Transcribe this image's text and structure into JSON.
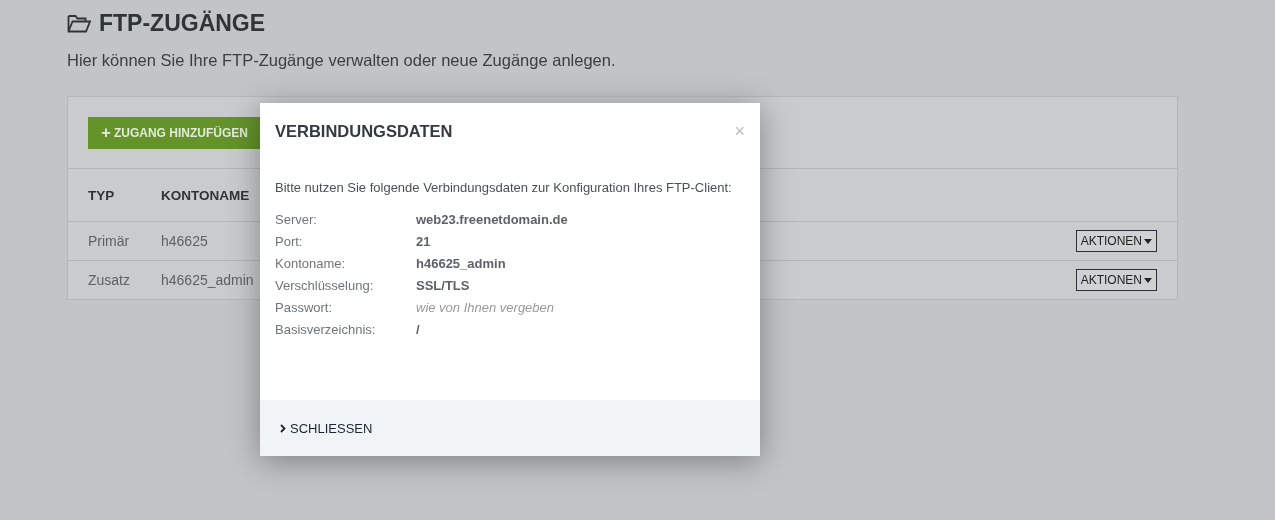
{
  "page": {
    "title": "FTP-ZUGÄNGE",
    "subtitle": "Hier können Sie Ihre FTP-Zugänge verwalten oder neue Zugänge anlegen."
  },
  "card": {
    "add_button": "ZUGANG HINZUFÜGEN",
    "add_icon": "+",
    "table": {
      "columns": [
        "TYP",
        "KONTONAME"
      ],
      "rows": [
        {
          "cells": [
            "Primär",
            "h46625"
          ],
          "action": "AKTIONEN"
        },
        {
          "cells": [
            "Zusatz",
            "h46625_admin"
          ],
          "action": "AKTIONEN"
        }
      ]
    }
  },
  "modal": {
    "title": "VERBINDUNGSDATEN",
    "close": "×",
    "intro": "Bitte nutzen Sie folgende Verbindungsdaten zur Konfiguration Ihres FTP-Client:",
    "details": [
      {
        "label": "Server:",
        "value": "web23.freenetdomain.de",
        "kind": "value"
      },
      {
        "label": "Port:",
        "value": "21",
        "kind": "value"
      },
      {
        "label": "Kontoname:",
        "value": "h46625_admin",
        "kind": "value"
      },
      {
        "label": "Verschlüsselung:",
        "value": "SSL/TLS",
        "kind": "value"
      },
      {
        "label": "Passwort:",
        "value": "wie von Ihnen vergeben",
        "kind": "hint"
      },
      {
        "label": "Basisverzeichnis:",
        "value": "/",
        "kind": "value"
      }
    ],
    "footer_button": "SCHLIESSEN"
  }
}
